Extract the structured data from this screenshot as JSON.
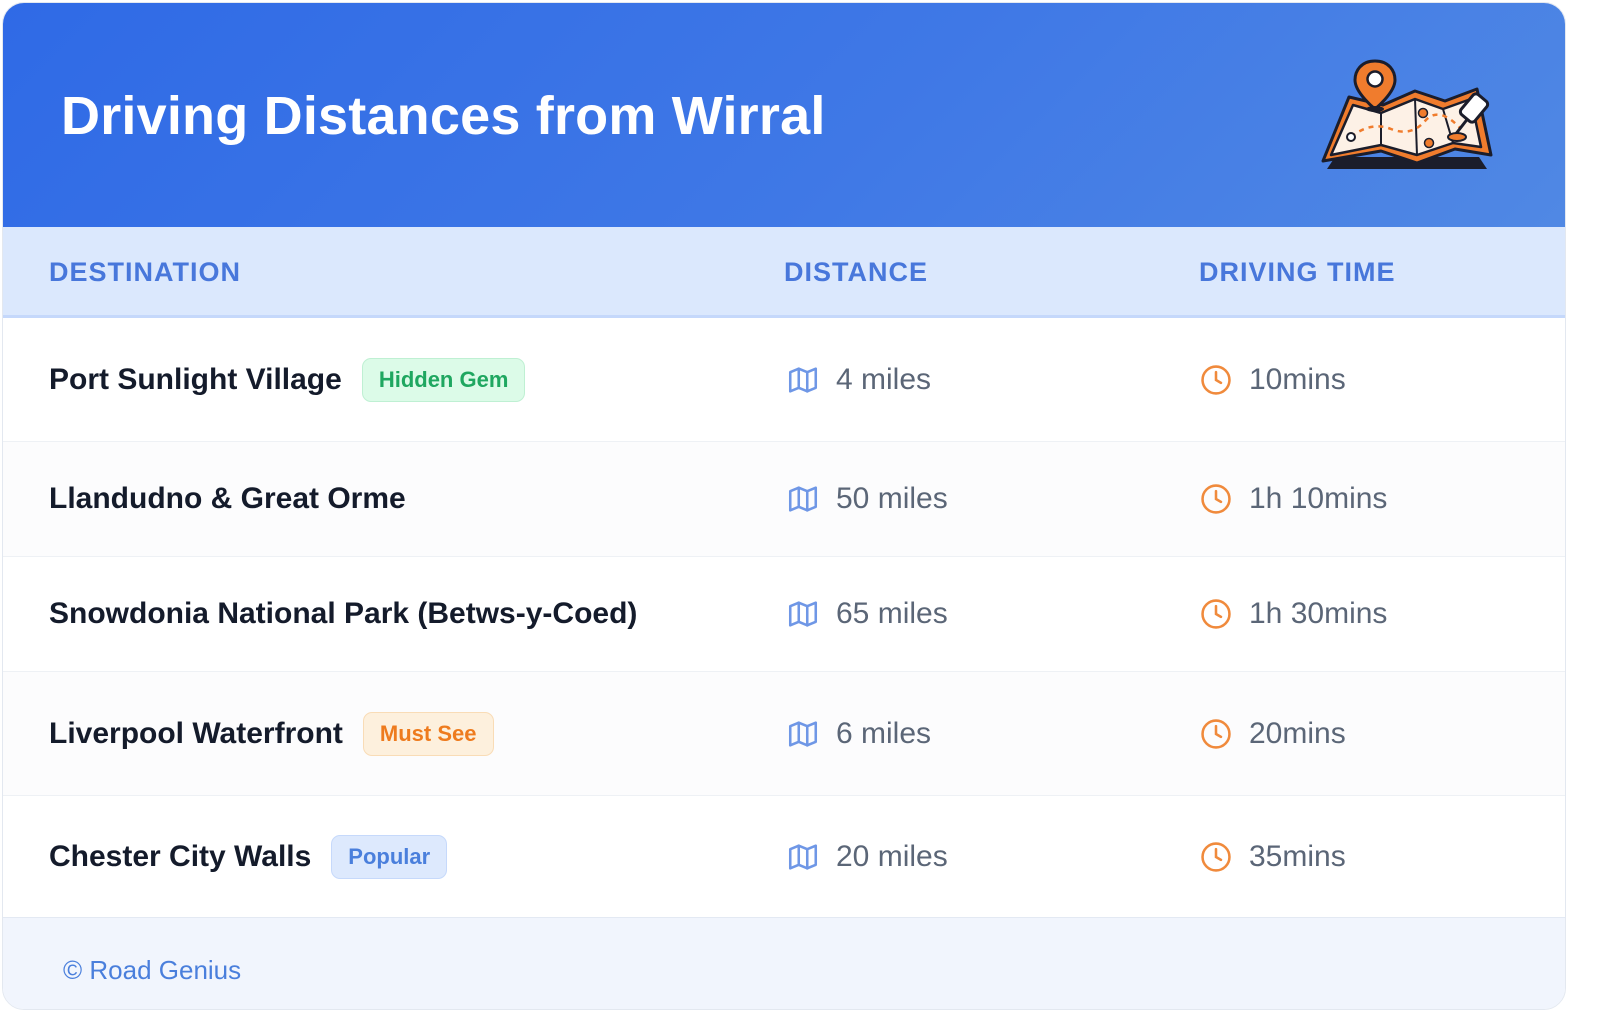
{
  "header": {
    "title": "Driving Distances from Wirral"
  },
  "table": {
    "columns": [
      "DESTINATION",
      "DISTANCE",
      "DRIVING TIME"
    ],
    "rows": [
      {
        "destination": "Port Sunlight Village",
        "badge": "Hidden Gem",
        "badge_color": "#1fa760",
        "distance": "4 miles",
        "time": "10mins"
      },
      {
        "destination": "Llandudno & Great Orme",
        "badge": "",
        "distance": "50 miles",
        "time": "1h 10mins"
      },
      {
        "destination": "Snowdonia National Park (Betws-y-Coed)",
        "badge": "",
        "distance": "65 miles",
        "time": "1h 30mins"
      },
      {
        "destination": "Liverpool Waterfront",
        "badge": "Must See",
        "badge_color": "#ee7b1e",
        "distance": "6 miles",
        "time": "20mins"
      },
      {
        "destination": "Chester City Walls",
        "badge": "Popular",
        "badge_color": "#4a7fdc",
        "distance": "20 miles",
        "time": "35mins"
      }
    ],
    "distance_icon": "map-icon",
    "time_icon": "clock-icon"
  },
  "footer": {
    "credit": "© Road Genius"
  },
  "colors": {
    "banner": "#2f6ae6",
    "header_text": "#4877db",
    "accent_orange": "#f08a3c",
    "icon_blue": "#6f97e6"
  }
}
